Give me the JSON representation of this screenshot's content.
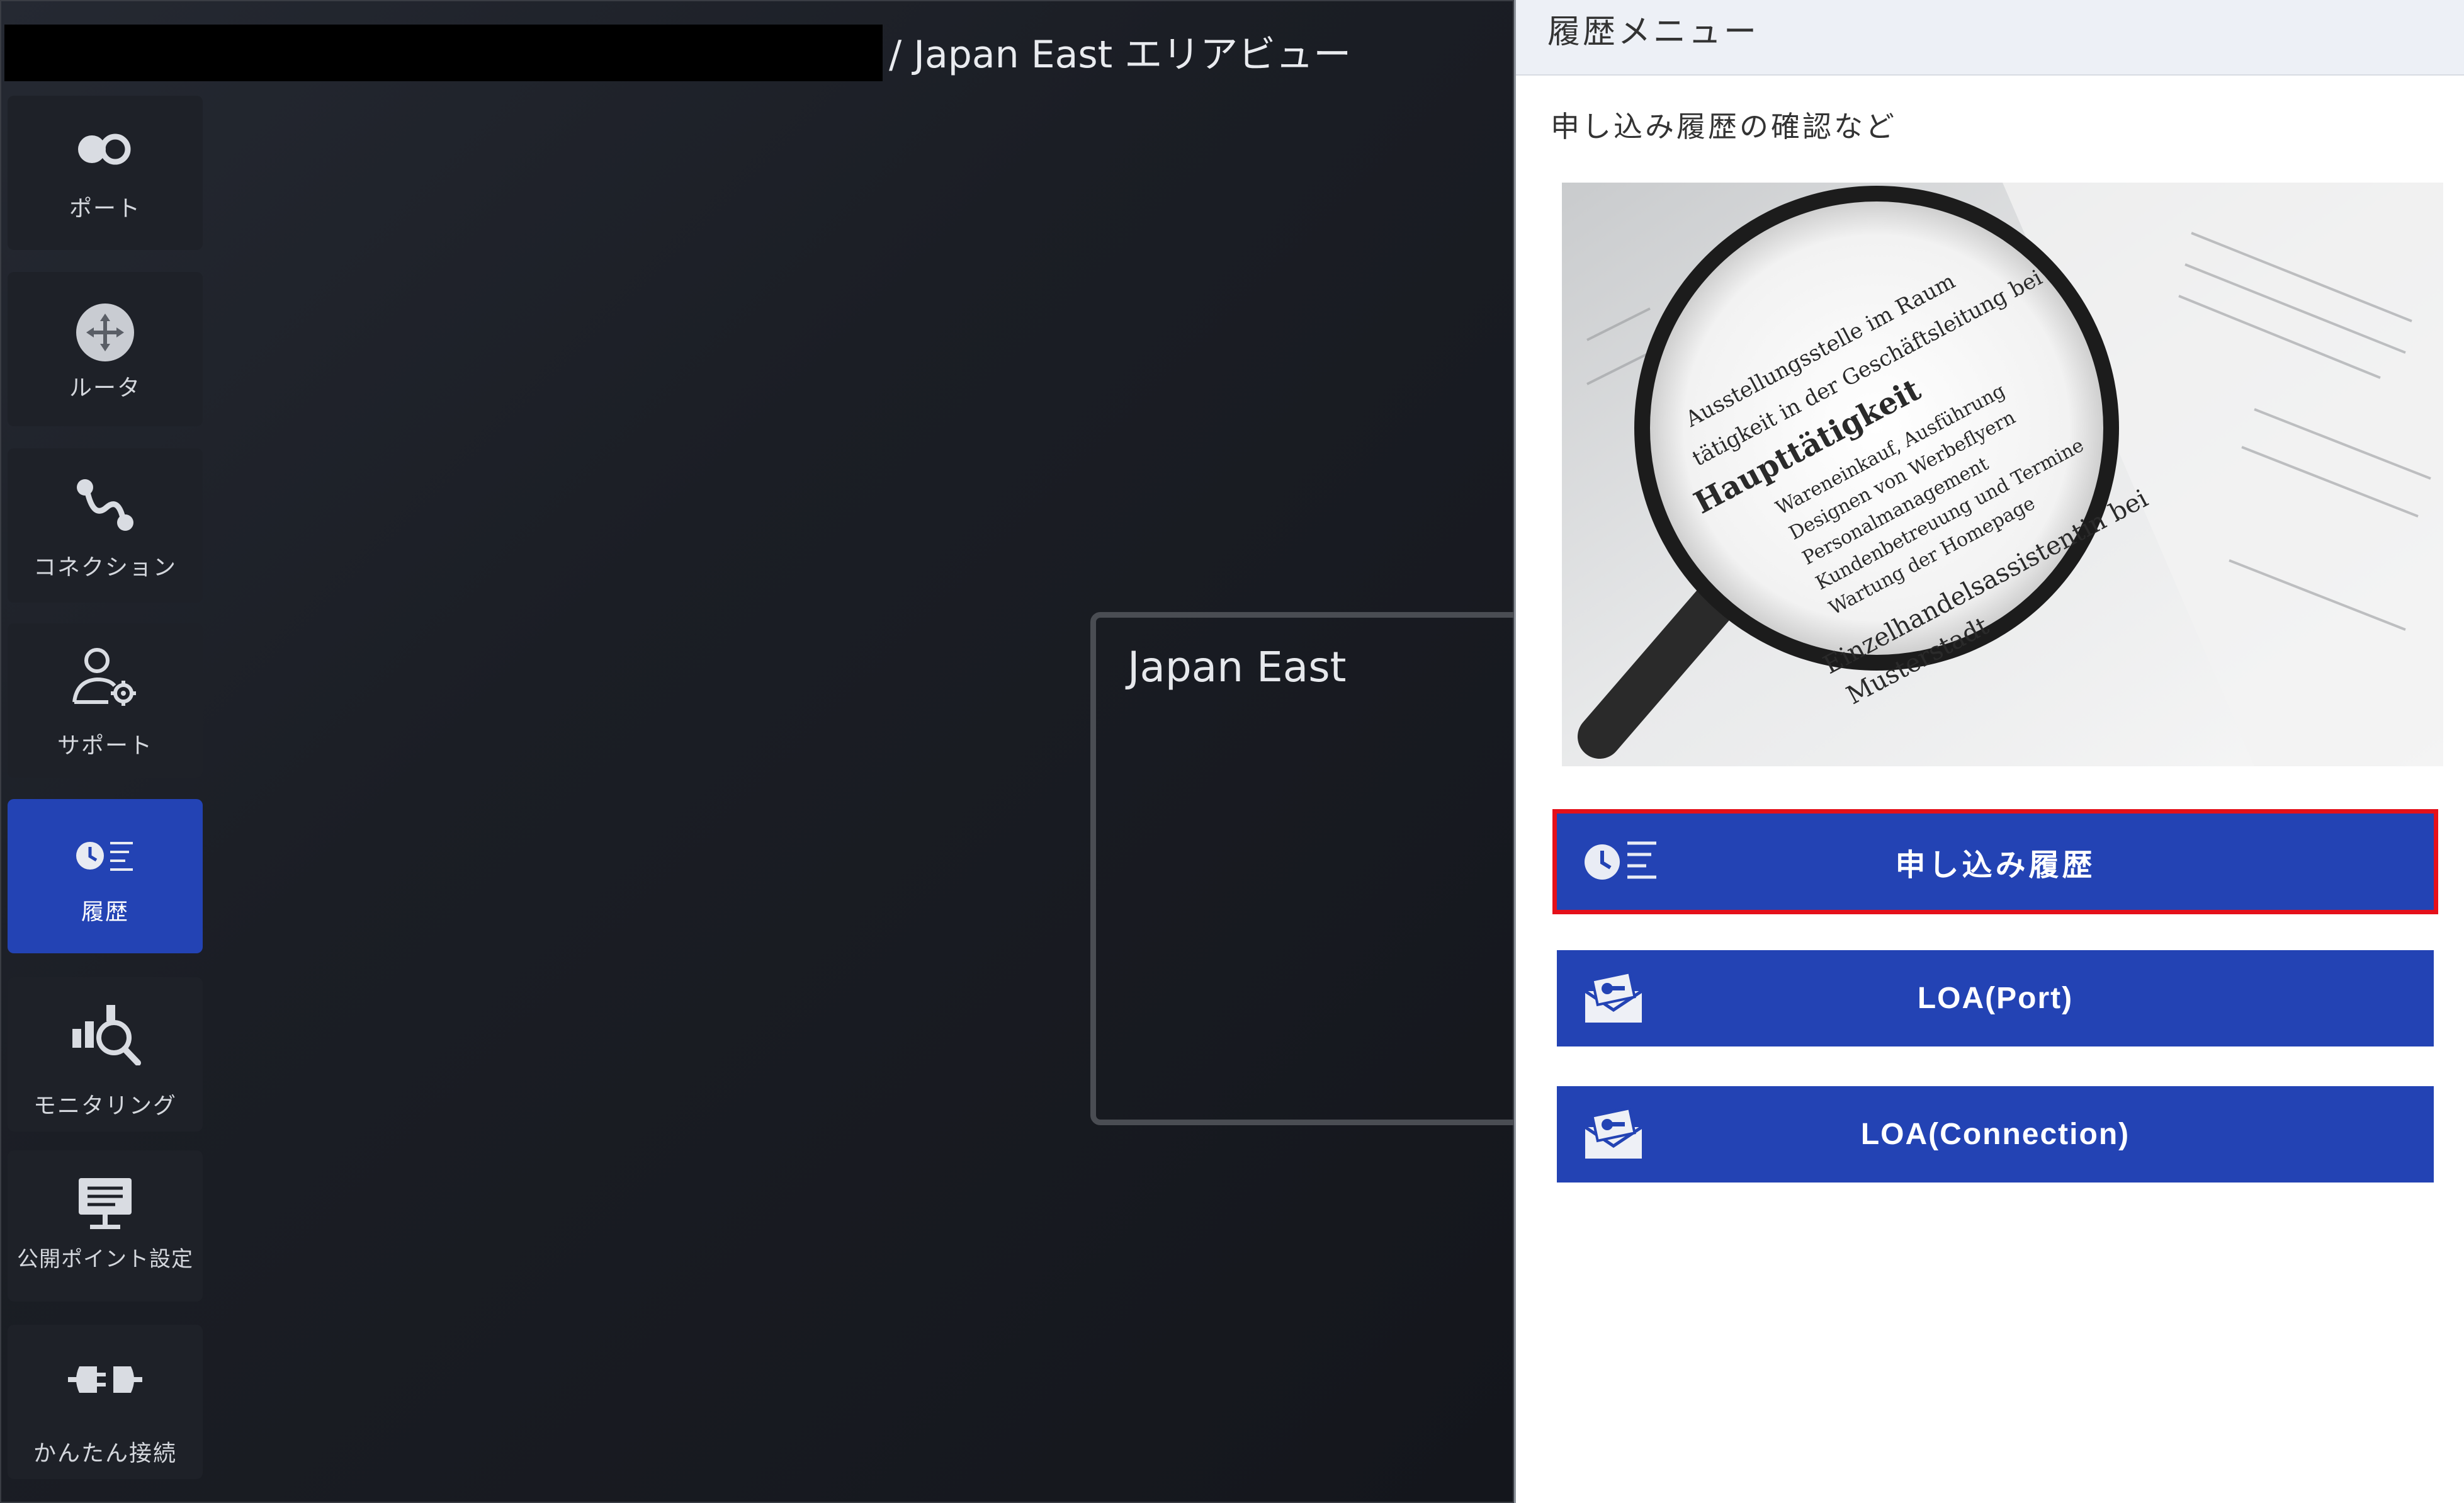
{
  "header": {
    "title_redacted": true,
    "breadcrumb": "/ Japan East エリアビュー"
  },
  "sidebar": {
    "items": [
      {
        "label": "ポート",
        "icon": "port-icon",
        "active": false
      },
      {
        "label": "ルータ",
        "icon": "router-icon",
        "active": false
      },
      {
        "label": "コネクション",
        "icon": "connection-icon",
        "active": false
      },
      {
        "label": "サポート",
        "icon": "support-icon",
        "active": false
      },
      {
        "label": "履歴",
        "icon": "history-icon",
        "active": true
      },
      {
        "label": "モニタリング",
        "icon": "monitoring-icon",
        "active": false
      },
      {
        "label": "公開ポイント設定",
        "icon": "public-point-icon",
        "active": false
      },
      {
        "label": "かんたん接続",
        "icon": "easy-connect-icon",
        "active": false
      }
    ]
  },
  "map": {
    "area_name": "Japan East"
  },
  "panel": {
    "title": "履歴メニュー",
    "subtitle": "申し込み履歴の確認など",
    "image_alt_icon": "magnifying-glass-document",
    "buttons": [
      {
        "label": "申し込み履歴",
        "icon": "history-icon",
        "highlighted": true
      },
      {
        "label": "LOA(Port)",
        "icon": "loa-envelope-icon",
        "highlighted": false
      },
      {
        "label": "LOA(Connection)",
        "icon": "loa-envelope-icon",
        "highlighted": false
      }
    ]
  },
  "colors": {
    "accent": "#2343b4",
    "highlight_border": "#e5101a",
    "panel_header_bg": "#edf0f6",
    "app_bg": "#1b1e25"
  }
}
